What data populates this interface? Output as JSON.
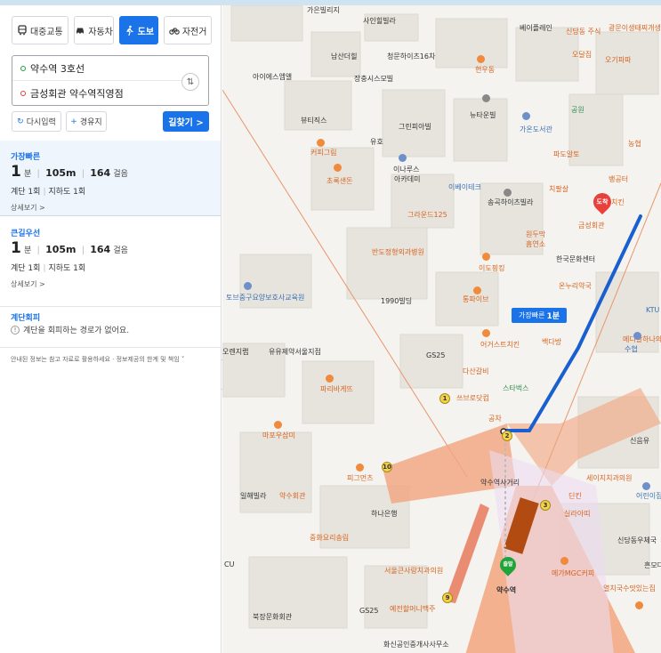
{
  "modes": [
    {
      "label": "대중교통",
      "icon": "bus-icon"
    },
    {
      "label": "자동차",
      "icon": "car-icon"
    },
    {
      "label": "도보",
      "icon": "walk-icon",
      "active": true
    },
    {
      "label": "자전거",
      "icon": "bicycle-icon"
    }
  ],
  "route": {
    "origin": "약수역 3호선",
    "destination": "금성회관 약수역직영점",
    "reset_label": "다시입력",
    "waypoint_label": "경유지",
    "search_label": "길찾기 >"
  },
  "results": [
    {
      "tag": "가장빠른",
      "minutes": "1",
      "min_unit": "분",
      "distance": "105m",
      "steps": "164",
      "steps_unit": "걸음",
      "stairs": "계단 1회",
      "underpass": "지하도 1회",
      "more": "상세보기 >"
    },
    {
      "tag": "큰길우선",
      "minutes": "1",
      "min_unit": "분",
      "distance": "105m",
      "steps": "164",
      "steps_unit": "걸음",
      "stairs": "계단 1회",
      "underpass": "지하도 1회",
      "more": "상세보기 >"
    }
  ],
  "detour": {
    "tag": "계단회피",
    "message": "계단을 회피하는 경로가 없어요."
  },
  "disclaimer": "안내된 정보는 참고 자료로 활용하세요 · 정보제공의 한계 및 책임 ˅",
  "map": {
    "walk_badge_label": "가장빠른",
    "walk_badge_time": "1분",
    "start_label": "출발",
    "end_label": "도착",
    "station_label": "약수역",
    "labels": {
      "samil": "사인힐빌라",
      "gaeunvilla": "가은빌리지",
      "namsan": "남산더힐",
      "cheongmun": "청문하이츠16차",
      "ayi": "아이에스엠앨",
      "jangchung": "장충시스모빌",
      "beauty": "뷰티직스",
      "yuho": "유호",
      "green": "그린피아빌",
      "hyunwoo": "현우동",
      "newtown": "뉴타운빌",
      "coffee": "커피그림",
      "chorok": "초록샌돈",
      "inarus": "이나루스",
      "akademi": "아카데미",
      "ibeiteukeu": "이베이테크",
      "grandeu": "그라운드125",
      "songwon": "송곡하이츠빌라",
      "wondu": "원두막",
      "heumyeon": "흠연소",
      "handeul": "반도정형외과병원",
      "idoman": "이도핑킹",
      "tongpa": "통파이브",
      "hanguk": "한국문화센터",
      "onnu": "온누리약국",
      "eogeu": "어거스트치킨",
      "baekda": "백다방",
      "dasan": "다산갈비",
      "ssbo": "쓰브로닷컴",
      "starbucks": "스타벅스",
      "gongcha": "공차",
      "gs25a": "GS25",
      "gs25b": "GS25",
      "1990": "1990빌딩",
      "tobo": "토브중구요양보호사교육원",
      "yuyu": "유유제약서울지점",
      "orange": "오렌지랩",
      "paris": "파리바게뜨",
      "mapo": "마포우삼미",
      "pikeon": "피그먼츠",
      "hana": "하나은행",
      "ilhye": "일해빌라",
      "yaksu": "약수회관",
      "jeongmin": "중화요리송림",
      "yaksusa": "약수역사거리",
      "seoul": "서울큰사랑치과의원",
      "yejeon": "예전할머니맥주",
      "hwasin": "화신공인중개사사무소",
      "bukjang": "북장문화회관",
      "meganc": "메가MGC커피",
      "yeolchi": "열치국수맛있는집",
      "silla": "실라아띠",
      "sindang": "신당동우체국",
      "seiji": "세이지치과의원",
      "dinkl": "딘킨",
      "gongwon": "공원",
      "pado": "파도알토",
      "jichi": "치킨",
      "baenglim": "뱅공터",
      "nongmyeop": "농협",
      "gaon": "가온도서관",
      "baeurine": "베이플레인",
      "sindangju": "신당동 주식",
      "odal": "오달집",
      "gwangmun": "광문이생태찌개생태구",
      "ogi": "오기파파",
      "chiptal": "치팔살",
      "geumseong": "금성회관",
      "medigal": "메디갈하나의",
      "sineum": "신음유",
      "suhyeop": "수협",
      "ktu": "KTU",
      "eobi": "어린이집",
      "cu": "CU",
      "ha_mod": "흔모다"
    }
  },
  "exits": [
    "1",
    "2",
    "3",
    "9",
    "10"
  ]
}
